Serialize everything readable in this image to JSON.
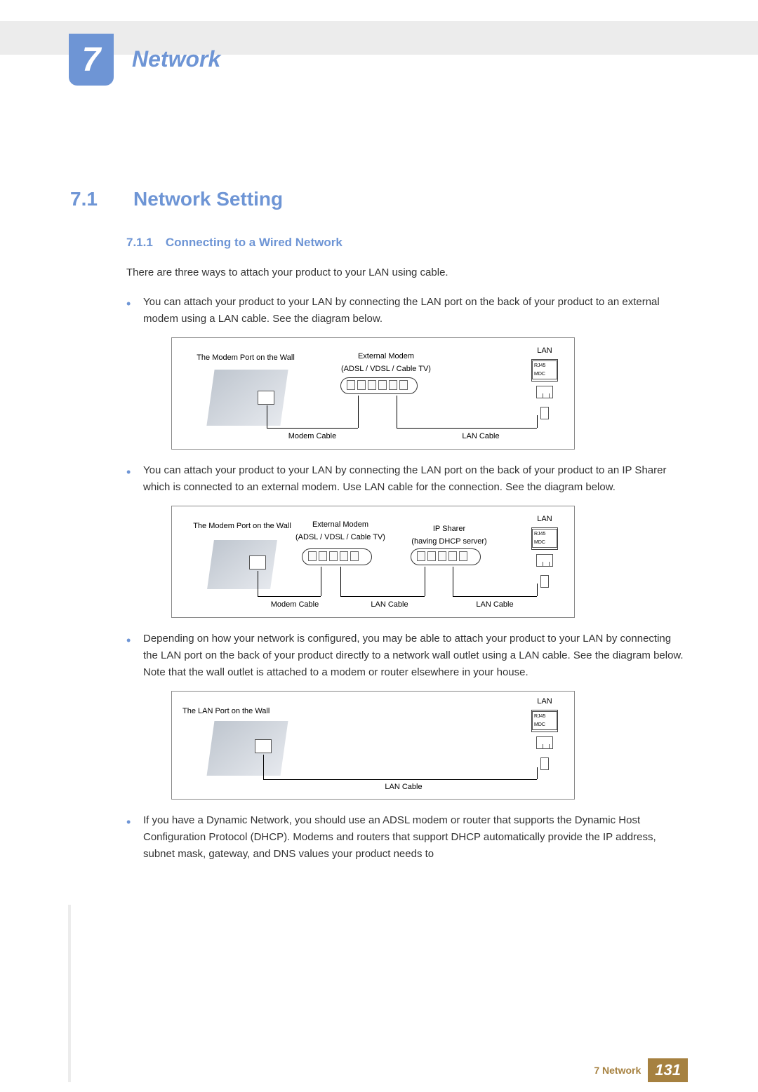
{
  "chapter": {
    "number": "7",
    "title": "Network"
  },
  "section": {
    "number": "7.1",
    "title": "Network Setting"
  },
  "subsection": {
    "number": "7.1.1",
    "title": "Connecting to a Wired Network"
  },
  "intro": "There are three ways to attach your product to your LAN using cable.",
  "bullets": [
    "You can attach your product to your LAN by connecting the LAN port on the back of your product to an external modem using a LAN cable. See the diagram below.",
    "You can attach your product to your LAN by connecting the LAN port on the back of your product to an IP Sharer which is connected to an external modem. Use LAN cable for the connection. See the diagram below.",
    "Depending on how your network is configured, you may be able to attach your product to your LAN by connecting the LAN port on the back of your product directly to a network wall outlet using a LAN cable. See the diagram below. Note that the wall outlet is attached to a modem or router elsewhere in your house.",
    "If you have a Dynamic Network, you should use an ADSL modem or router that supports the Dynamic Host Configuration Protocol (DHCP). Modems and routers that support DHCP automatically provide the IP address, subnet mask, gateway, and DNS values your product needs to"
  ],
  "diagram1": {
    "wall_label": "The Modem Port on the Wall",
    "modem_label_1": "External Modem",
    "modem_label_2": "(ADSL / VDSL / Cable TV)",
    "lan_title": "LAN",
    "rj_label": "RJ45 MDC",
    "modem_cable": "Modem Cable",
    "lan_cable": "LAN Cable"
  },
  "diagram2": {
    "wall_label": "The Modem Port on the Wall",
    "modem_label_1": "External Modem",
    "modem_label_2": "(ADSL / VDSL / Cable TV)",
    "sharer_label_1": "IP Sharer",
    "sharer_label_2": "(having DHCP server)",
    "lan_title": "LAN",
    "rj_label": "RJ45 MDC",
    "modem_cable": "Modem Cable",
    "lan_cable_1": "LAN Cable",
    "lan_cable_2": "LAN Cable"
  },
  "diagram3": {
    "wall_label": "The LAN Port on the Wall",
    "lan_title": "LAN",
    "rj_label": "RJ45 MDC",
    "lan_cable": "LAN Cable"
  },
  "footer": {
    "label": "7 Network",
    "page": "131"
  }
}
